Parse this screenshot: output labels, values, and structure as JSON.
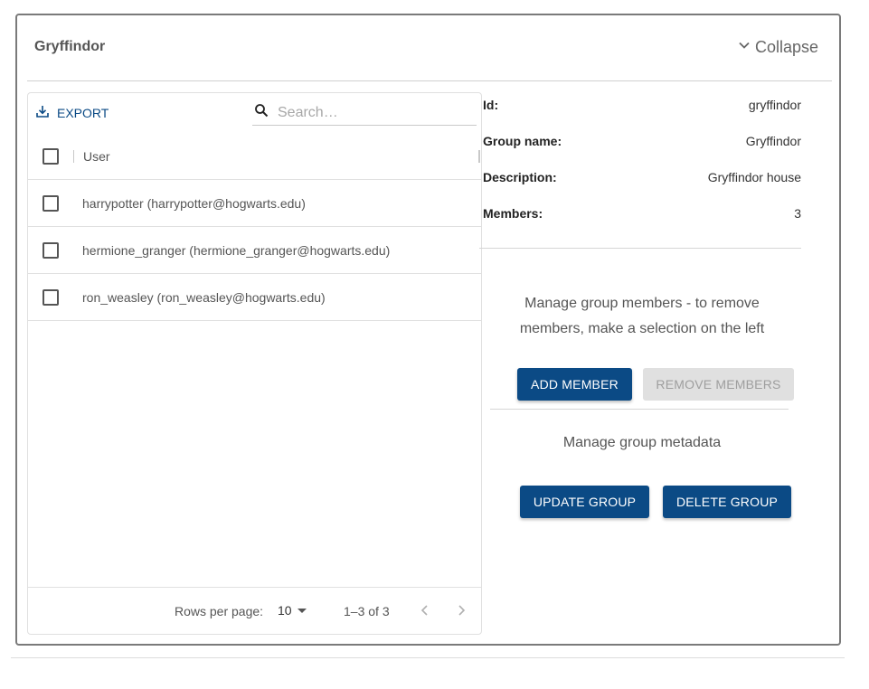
{
  "card": {
    "title": "Gryffindor",
    "collapse_label": "Collapse"
  },
  "grid": {
    "export_label": "EXPORT",
    "search_placeholder": "Search…",
    "column_user": "User",
    "rows": [
      {
        "user": "harrypotter (harrypotter@hogwarts.edu)"
      },
      {
        "user": "hermione_granger (hermione_granger@hogwarts.edu)"
      },
      {
        "user": "ron_weasley (ron_weasley@hogwarts.edu)"
      }
    ],
    "footer": {
      "rows_per_page_label": "Rows per page:",
      "rows_per_page_value": "10",
      "range": "1–3 of 3"
    }
  },
  "details": {
    "fields": [
      {
        "key": "Id:",
        "value": "gryffindor"
      },
      {
        "key": "Group name:",
        "value": "Gryffindor"
      },
      {
        "key": "Description:",
        "value": "Gryffindor house"
      },
      {
        "key": "Members:",
        "value": "3"
      }
    ],
    "manage_members_text": "Manage group members - to remove members, make a selection on the left",
    "add_member_label": "ADD MEMBER",
    "remove_members_label": "REMOVE MEMBERS",
    "manage_metadata_text": "Manage group metadata",
    "update_group_label": "UPDATE GROUP",
    "delete_group_label": "DELETE GROUP"
  },
  "colors": {
    "primary": "#0b4a85",
    "disabled_bg": "#e0e0e0",
    "border": "#7a7a7a"
  },
  "icons": [
    "chevron-down-icon",
    "download-icon",
    "search-icon",
    "caret-down-icon",
    "chevron-left-icon",
    "chevron-right-icon"
  ]
}
